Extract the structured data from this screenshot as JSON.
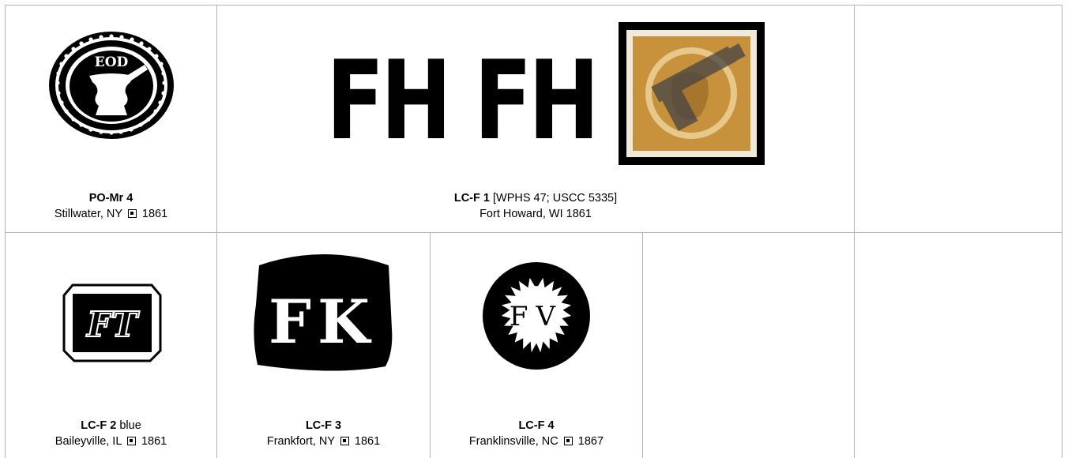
{
  "cells": [
    {
      "id": "PO-Mr 4",
      "desc": "",
      "place": "Stillwater, NY",
      "year": "1861",
      "stamp_letters": "EOD"
    },
    {
      "id": "LC-F 1",
      "desc": "[WPHS 47; USCC 5335]",
      "place": "Fort Howard, WI",
      "year": "1861",
      "stamp_letters": "FH FH"
    },
    {
      "id": "LC-F 2",
      "desc": "blue",
      "place": "Baileyville, IL",
      "year": "1861",
      "stamp_letters": "FT"
    },
    {
      "id": "LC-F 3",
      "desc": "",
      "place": "Frankfort, NY",
      "year": "1861",
      "stamp_letters": "FK"
    },
    {
      "id": "LC-F 4",
      "desc": "",
      "place": "Franklinsville, NC",
      "year": "1867",
      "stamp_letters": "FV"
    }
  ],
  "colors": {
    "grid_line": "#b4b4b4",
    "stamp_ink": "#000000",
    "postage_stamp": "#c8913c"
  }
}
